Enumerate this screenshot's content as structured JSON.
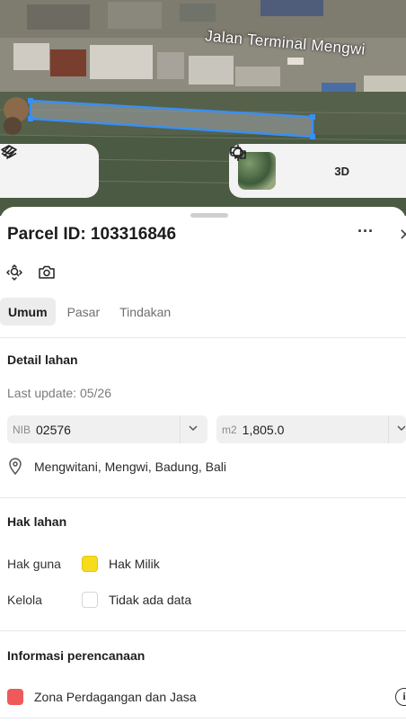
{
  "map": {
    "road_label": "Jalan Terminal Mengwi",
    "view_3d_label": "3D",
    "parcel_outline_color": "#3a8ff0",
    "icons": [
      "layers-icon",
      "route-icon",
      "satellite-thumbnail",
      "locate-icon",
      "compare-icon"
    ]
  },
  "sheet": {
    "title": "Parcel ID: 103316846",
    "more_label": "···",
    "close_label": "✕",
    "tools": [
      "zoom-to-parcel-icon",
      "camera-icon"
    ],
    "tabs": [
      {
        "label": "Umum",
        "active": true
      },
      {
        "label": "Pasar",
        "active": false
      },
      {
        "label": "Tindakan",
        "active": false
      }
    ]
  },
  "detail": {
    "heading": "Detail lahan",
    "last_update": "Last update: 05/26",
    "nib": {
      "prefix": "NIB",
      "value": "02576"
    },
    "area": {
      "prefix": "m2",
      "value": "1,805.0"
    },
    "location": "Mengwitani, Mengwi, Badung, Bali"
  },
  "hak": {
    "heading": "Hak lahan",
    "rows": [
      {
        "key": "Hak guna",
        "value": "Hak Milik",
        "color": "#f7dc1c"
      },
      {
        "key": "Kelola",
        "value": "Tidak ada data",
        "color": "#ffffff"
      }
    ]
  },
  "planning": {
    "heading": "Informasi perencanaan",
    "zone": "Zona Perdagangan dan Jasa",
    "zone_color": "#ee5a5a"
  }
}
